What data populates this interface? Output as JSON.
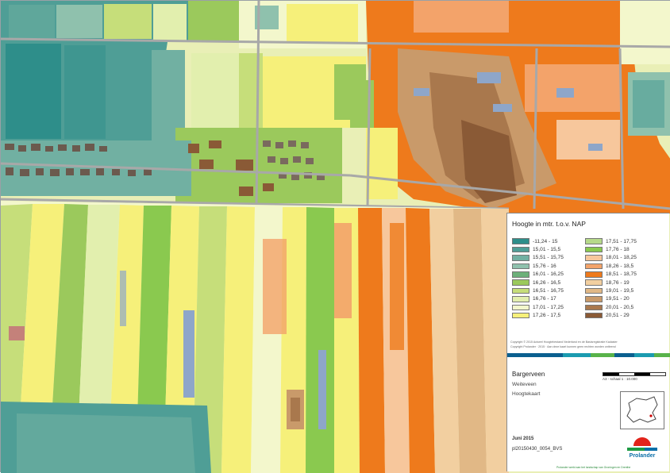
{
  "legend": {
    "title": "Hoogte in mtr. t.o.v. NAP",
    "column1": [
      {
        "label": "-11,24 - 15",
        "color": "#2e8e8a"
      },
      {
        "label": "15,01 - 15,5",
        "color": "#4f9e96"
      },
      {
        "label": "15,51 - 15,75",
        "color": "#71b0a2"
      },
      {
        "label": "15,76 - 16",
        "color": "#8fc1ad"
      },
      {
        "label": "16,01 - 16,25",
        "color": "#6db07a"
      },
      {
        "label": "16,26 - 16,5",
        "color": "#9bc95c"
      },
      {
        "label": "16,51 - 16,75",
        "color": "#c6de7a"
      },
      {
        "label": "16,76 - 17",
        "color": "#e2efae"
      },
      {
        "label": "17,01 - 17,25",
        "color": "#f3f7cc"
      },
      {
        "label": "17,26 - 17,5",
        "color": "#f6f07a"
      }
    ],
    "column2": [
      {
        "label": "17,51 - 17,75",
        "color": "#b6d98a"
      },
      {
        "label": "17,76 - 18",
        "color": "#8ac94f"
      },
      {
        "label": "18,01 - 18,25",
        "color": "#f7c79c"
      },
      {
        "label": "18,26 - 18,5",
        "color": "#f3a36a"
      },
      {
        "label": "18,51 - 18,75",
        "color": "#ee7a1c"
      },
      {
        "label": "18,76 - 19",
        "color": "#f2cfa0"
      },
      {
        "label": "19,01 - 19,5",
        "color": "#e1b886"
      },
      {
        "label": "19,51 - 20",
        "color": "#c99a6a"
      },
      {
        "label": "20,01 - 20,5",
        "color": "#a9784d"
      },
      {
        "label": "20,51 - 29",
        "color": "#8a5a36"
      }
    ],
    "copyright_line1": "Copyright © 2015 Actueel Hoogtebestand Nederland en de Basisregistratie Kadaster",
    "copyright_line2": "Copyright Prolander · 2015 · Aan deze kaart kunnen geen rechten worden ontleend"
  },
  "colorbar": [
    "#0b5f8f",
    "#1b9bb0",
    "#58b34a",
    "#0b5f8f",
    "#1b9bb0",
    "#58b34a"
  ],
  "project": {
    "title": "Bargerveen",
    "subtitle1": "Weiteveen",
    "subtitle2": "Hoogtekaart",
    "scale": "A3 - schaal 1 : 10.000",
    "date": "Juni 2015",
    "code": "pl20150430_0054_BVS"
  },
  "logo": {
    "name": "Prolander",
    "red": "#e2231a",
    "green": "#1e9b44",
    "blue": "#0b6fa8"
  },
  "footer": "Prolander werkt aan het landschap van Groningen en Drenthe"
}
